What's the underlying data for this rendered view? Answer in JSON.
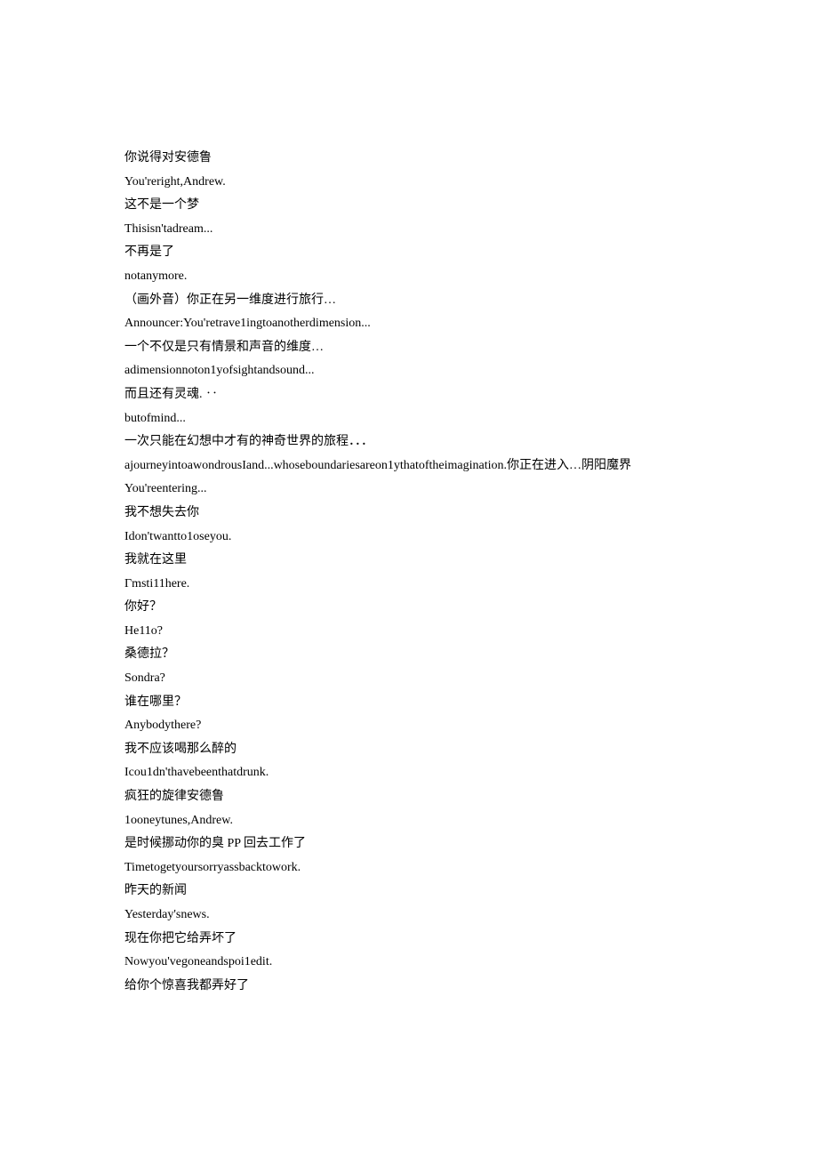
{
  "lines": [
    "你说得对安德鲁",
    "You'reright,Andrew.",
    "这不是一个梦",
    "Thisisn'tadream...",
    "不再是了",
    "notanymore.",
    "（画外音）你正在另一维度进行旅行…",
    "Announcer:You'retrave1ingtoanotherdimension...",
    "一个不仅是只有情景和声音的维度…",
    "adimensionnoton1yofsightandsound...",
    "而且还有灵魂. ‥",
    "butofmind...",
    "一次只能在幻想中才有的神奇世界的旅程．．．",
    "ajourneyintoawondrousIand...whoseboundariesareon1ythatoftheimagination.你正在进入…阴阳魔界",
    "You'reentering...",
    "我不想失去你",
    "Idon'twantto1oseyou.",
    "我就在这里",
    "Гmsti11here.",
    "你好？",
    "He11o?",
    "桑德拉？",
    "Sondra?",
    "谁在哪里？",
    "Anybodythere?",
    "我不应该喝那么醉的",
    "Icou1dn'thavebeenthatdrunk.",
    "疯狂的旋律安德鲁",
    "1ooneytunes,Andrew.",
    "是时候挪动你的臭 PP 回去工作了",
    "Timetogetyoursorryassbacktowork.",
    "昨天的新闻",
    "Yesterday'snews.",
    "现在你把它给弄坏了",
    "Nowyou'vegoneandspoi1edit.",
    "给你个惊喜我都弄好了"
  ]
}
